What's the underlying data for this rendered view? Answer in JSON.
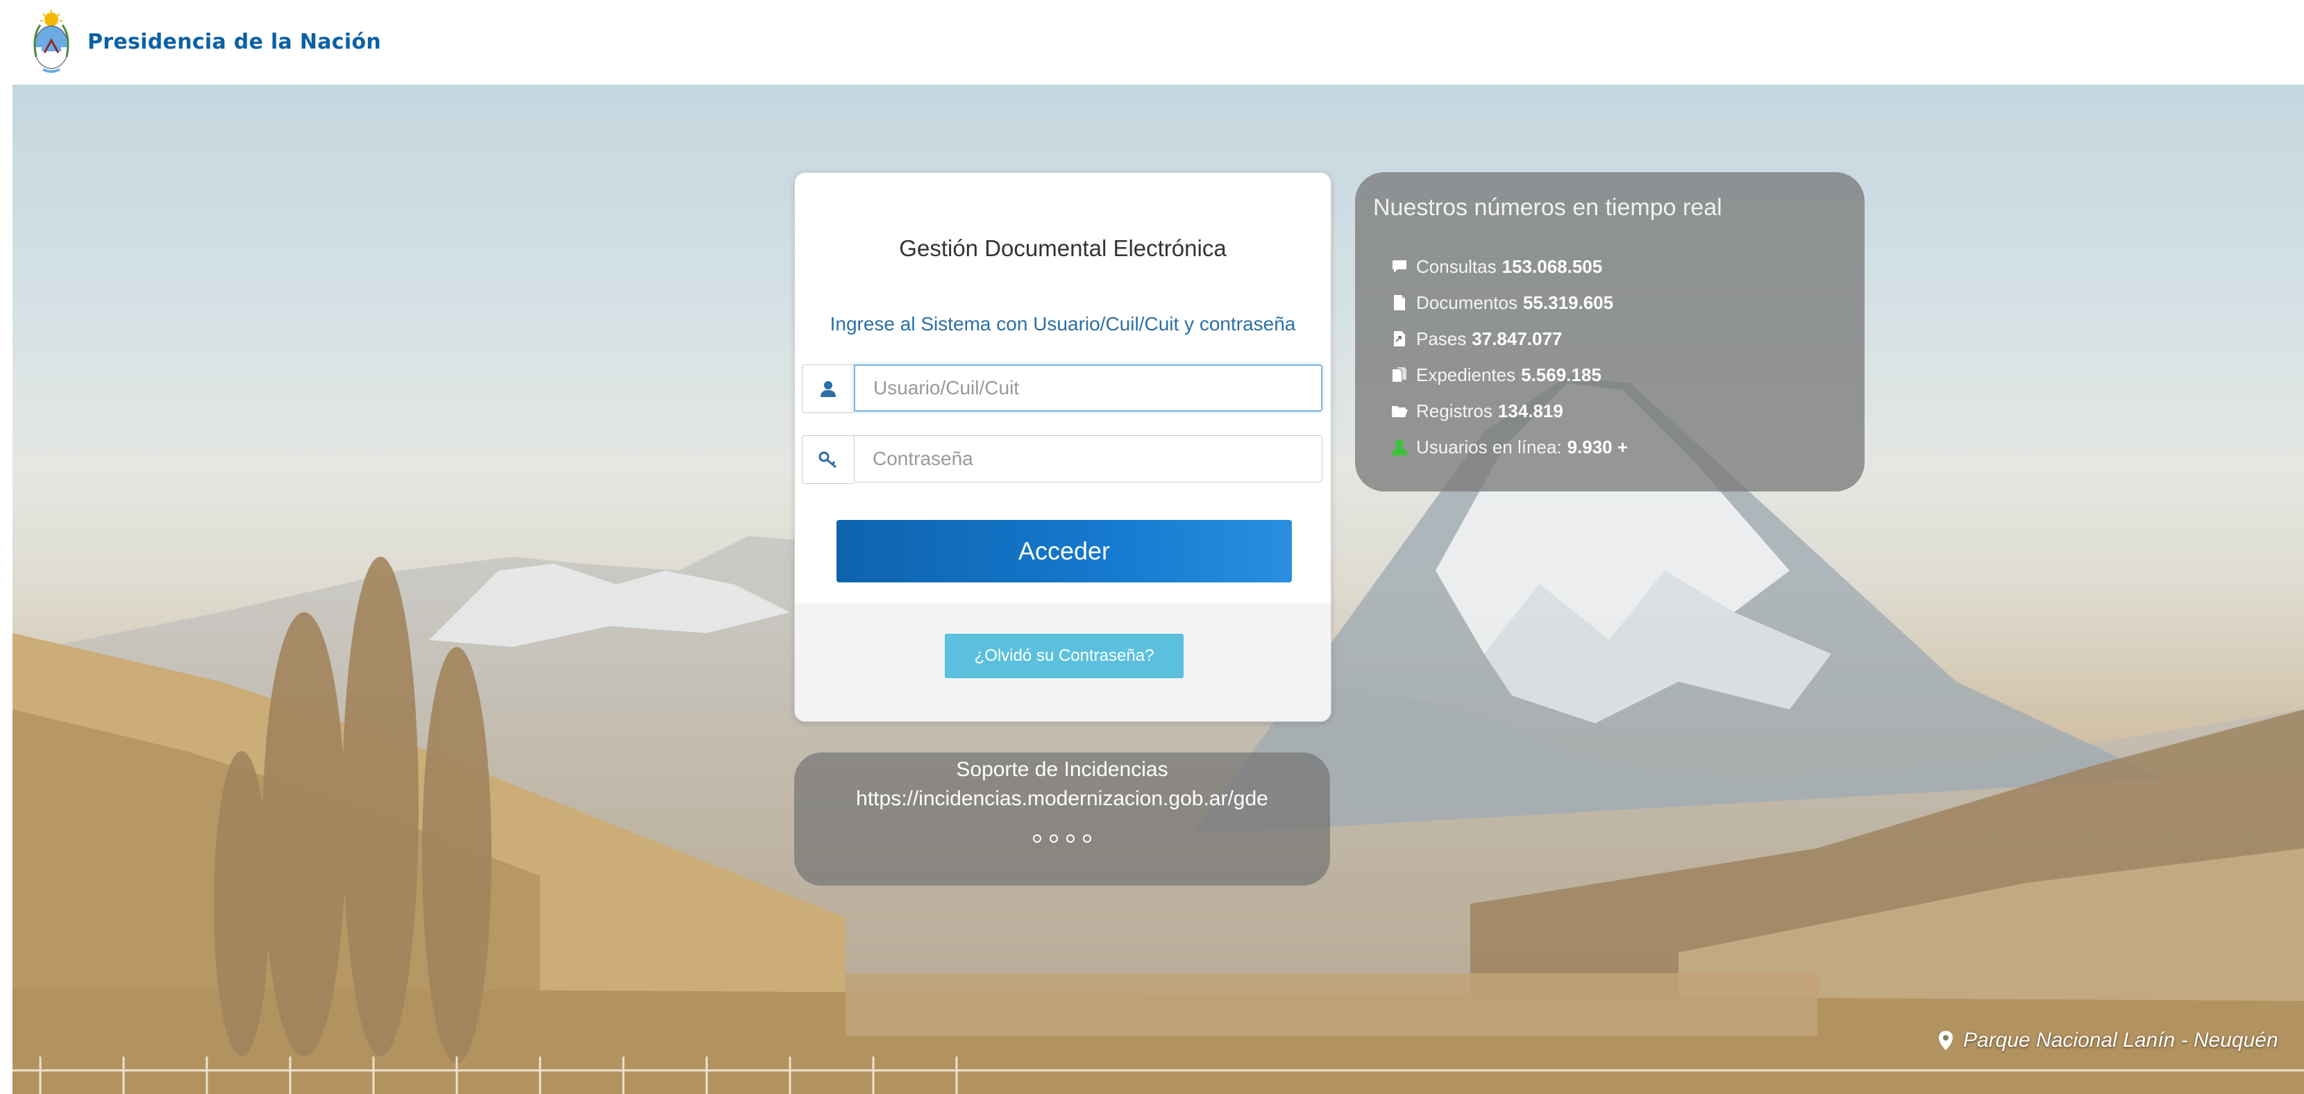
{
  "header": {
    "brand": "Presidencia de la Nación",
    "logo_icon": "argentina-coat-of-arms-icon"
  },
  "login": {
    "title": "Gestión Documental Electrónica",
    "subtitle": "Ingrese al Sistema con Usuario/Cuil/Cuit y contraseña",
    "user_placeholder": "Usuario/Cuil/Cuit",
    "user_value": "",
    "password_placeholder": "Contraseña",
    "password_value": "",
    "submit_label": "Acceder",
    "forgot_label": "¿Olvidó su Contraseña?"
  },
  "stats": {
    "title": "Nuestros números en tiempo real",
    "items": [
      {
        "label": "Consultas",
        "value": "153.068.505",
        "icon": "comment-icon"
      },
      {
        "label": "Documentos",
        "value": "55.319.605",
        "icon": "document-icon"
      },
      {
        "label": "Pases",
        "value": "37.847.077",
        "icon": "transfer-icon"
      },
      {
        "label": "Expedientes",
        "value": "5.569.185",
        "icon": "files-icon"
      },
      {
        "label": "Registros",
        "value": "134.819",
        "icon": "folder-open-icon"
      },
      {
        "label": "Usuarios en línea:",
        "value": "9.930 +",
        "icon": "user-online-icon"
      }
    ]
  },
  "support": {
    "title": "Soporte de Incidencias",
    "url": "https://incidencias.modernizacion.gob.ar/gde"
  },
  "caption": {
    "text": "Parque Nacional Lanín - Neuquén",
    "icon": "map-pin-icon"
  },
  "colors": {
    "brand_blue": "#0b61a4",
    "button_blue": "#1579cf",
    "info_button": "#5bc0de",
    "link_blue": "#2a6fa8",
    "online_green": "#3cc23c"
  }
}
